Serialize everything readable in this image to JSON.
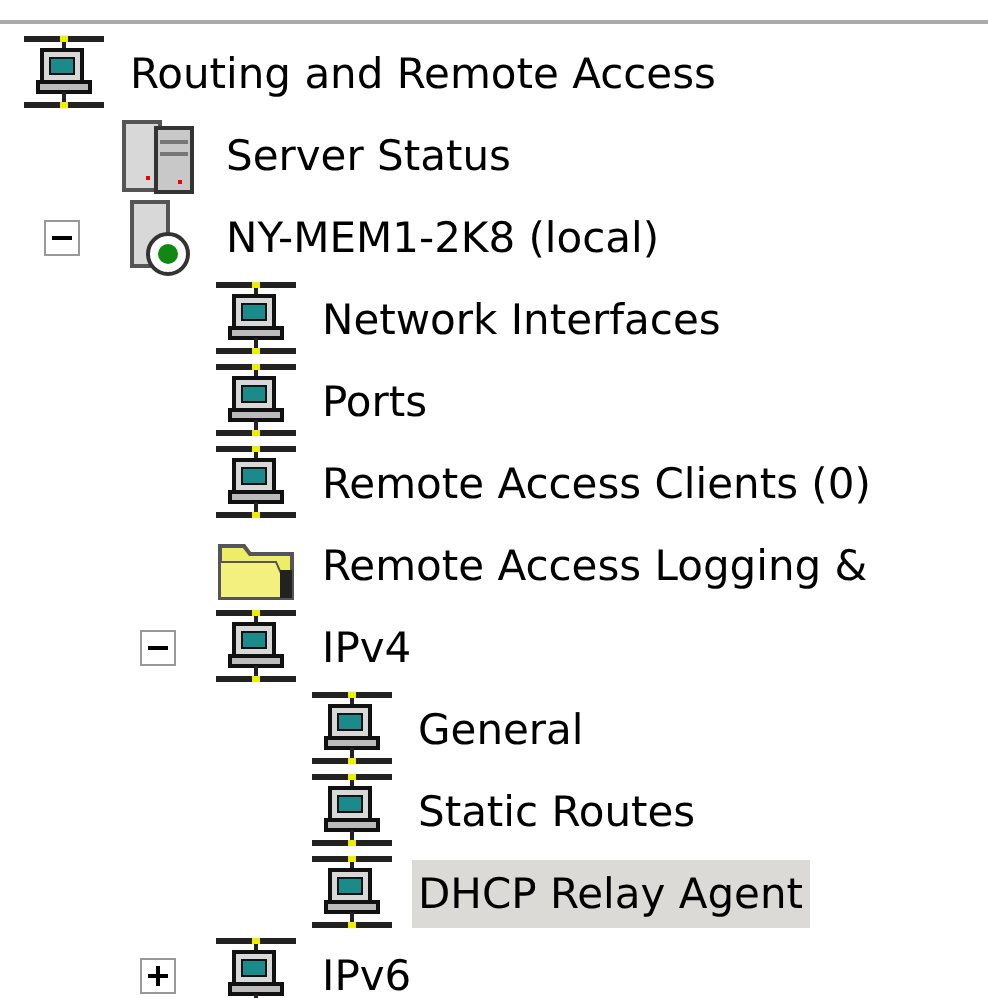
{
  "tree": [
    {
      "label": "Routing and Remote Access",
      "kind": "computer",
      "selected": false,
      "children": [
        {
          "label": "Server Status",
          "kind": "servers",
          "selected": false
        },
        {
          "label": "NY-MEM1-2K8 (local)",
          "kind": "server",
          "selected": false,
          "expanded": true,
          "children": [
            {
              "label": "Network Interfaces",
              "kind": "computer",
              "selected": false
            },
            {
              "label": "Ports",
              "kind": "computer",
              "selected": false
            },
            {
              "label": "Remote Access Clients (0)",
              "kind": "computer",
              "selected": false
            },
            {
              "label": "Remote Access Logging &",
              "kind": "folder",
              "selected": false
            },
            {
              "label": "IPv4",
              "kind": "computer",
              "selected": false,
              "expanded": true,
              "children": [
                {
                  "label": "General",
                  "kind": "computer",
                  "selected": false
                },
                {
                  "label": "Static Routes",
                  "kind": "computer",
                  "selected": false
                },
                {
                  "label": "DHCP Relay Agent",
                  "kind": "computer",
                  "selected": true
                }
              ]
            },
            {
              "label": "IPv6",
              "kind": "computer",
              "selected": false,
              "expanded": false
            }
          ]
        }
      ]
    }
  ]
}
